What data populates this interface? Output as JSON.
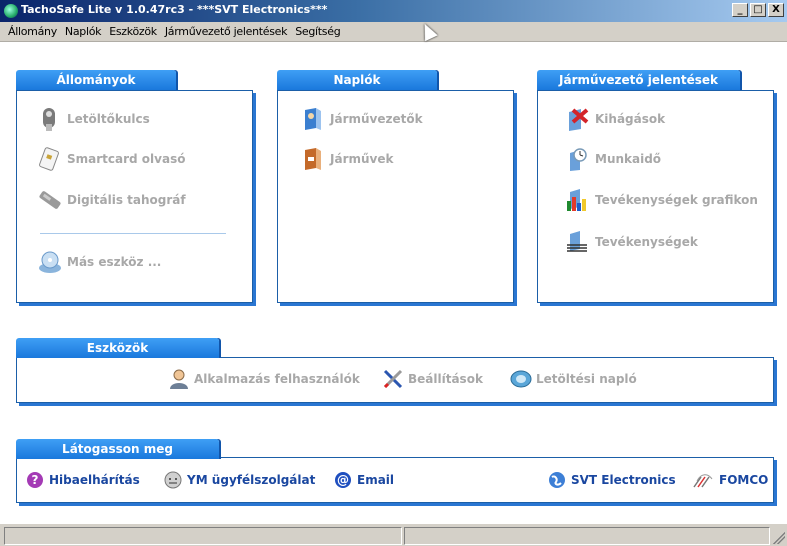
{
  "window": {
    "title": "TachoSafe Lite v 1.0.47rc3 - ***SVT Electronics***",
    "minimize_glyph": "_",
    "maximize_glyph": "□",
    "close_glyph": "X",
    "app_icon": "app-icon"
  },
  "menu": [
    "Állomány",
    "Naplók",
    "Eszközök",
    "Járművezető jelentések",
    "Segítség"
  ],
  "panels": {
    "allomanyok": {
      "title": "Állományok",
      "items": [
        {
          "label": "Letöltőkulcs",
          "icon": "download-key-icon"
        },
        {
          "label": "Smartcard olvasó",
          "icon": "smartcard-reader-icon"
        },
        {
          "label": "Digitális tahográf",
          "icon": "digital-tachograph-icon"
        },
        {
          "label": "Más eszköz ...",
          "icon": "other-device-icon"
        }
      ]
    },
    "naplok": {
      "title": "Naplók",
      "items": [
        {
          "label": "Járművezetők",
          "icon": "drivers-icon"
        },
        {
          "label": "Járművek",
          "icon": "vehicles-icon"
        }
      ]
    },
    "jelentesek": {
      "title": "Járművezető jelentések",
      "items": [
        {
          "label": "Kihágások",
          "icon": "violations-icon"
        },
        {
          "label": "Munkaidő",
          "icon": "worktime-icon"
        },
        {
          "label": "Tevékenységek grafikon",
          "icon": "activity-chart-icon"
        },
        {
          "label": "Tevékenységek",
          "icon": "activities-icon"
        }
      ]
    },
    "eszkozok": {
      "title": "Eszközök",
      "items": [
        {
          "label": "Alkalmazás felhasználók",
          "icon": "app-users-icon"
        },
        {
          "label": "Beállítások",
          "icon": "settings-icon"
        },
        {
          "label": "Letöltési napló",
          "icon": "download-log-icon"
        }
      ]
    },
    "latogasson": {
      "title": "Látogasson meg",
      "links": [
        {
          "label": "Hibaelhárítás",
          "icon": "help-icon"
        },
        {
          "label": "YM ügyfélszolgálat",
          "icon": "support-icon"
        },
        {
          "label": "Email",
          "icon": "email-icon"
        },
        {
          "label": "SVT Electronics",
          "icon": "globe-icon"
        },
        {
          "label": "FOMCO",
          "icon": "fomco-logo-icon"
        }
      ]
    }
  },
  "status": [
    "",
    ""
  ],
  "colors": {
    "tab": "#1a78dc",
    "panel_border": "#1b5fa8",
    "link": "#1a47a0",
    "disabled_text": "#a8a8a8"
  }
}
